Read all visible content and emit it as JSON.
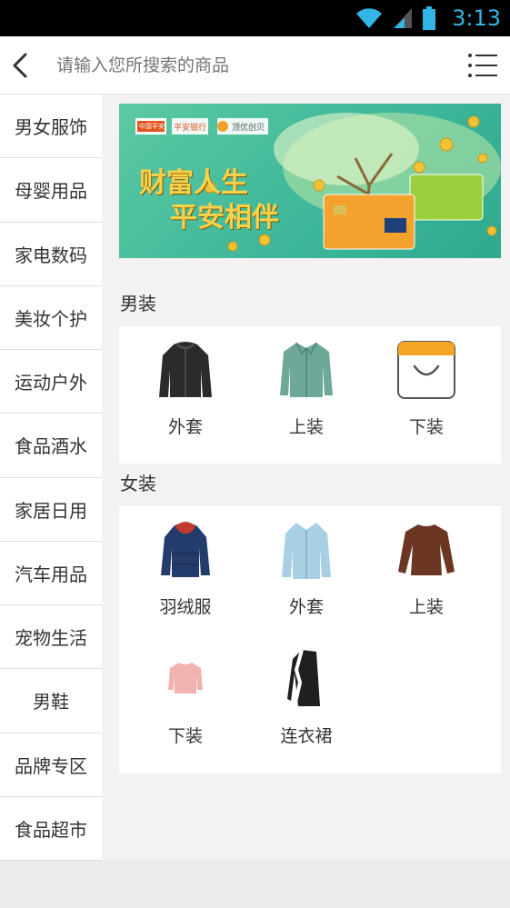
{
  "status": {
    "time": "3:13"
  },
  "search": {
    "placeholder": "请输入您所搜索的商品"
  },
  "sidebar": {
    "items": [
      {
        "label": "男女服饰"
      },
      {
        "label": "母婴用品"
      },
      {
        "label": "家电数码"
      },
      {
        "label": "美妆个护"
      },
      {
        "label": "运动户外"
      },
      {
        "label": "食品酒水"
      },
      {
        "label": "家居日用"
      },
      {
        "label": "汽车用品"
      },
      {
        "label": "宠物生活"
      },
      {
        "label": "男鞋"
      },
      {
        "label": "品牌专区"
      },
      {
        "label": "食品超市"
      }
    ]
  },
  "banner": {
    "logos": [
      "中国平安",
      "平安银行",
      "顶优创贝"
    ],
    "slogan_line1": "财富人生",
    "slogan_line2": "平安相伴"
  },
  "sections": [
    {
      "title": "男装",
      "items": [
        {
          "label": "外套",
          "icon": "jacket-icon"
        },
        {
          "label": "上装",
          "icon": "shirt-icon"
        },
        {
          "label": "下装",
          "icon": "shopping-bag-icon"
        }
      ]
    },
    {
      "title": "女装",
      "items": [
        {
          "label": "羽绒服",
          "icon": "down-jacket-icon"
        },
        {
          "label": "外套",
          "icon": "coat-icon"
        },
        {
          "label": "上装",
          "icon": "sweater-icon"
        },
        {
          "label": "下装",
          "icon": "pink-top-icon"
        },
        {
          "label": "连衣裙",
          "icon": "dress-icon"
        }
      ]
    }
  ],
  "colors": {
    "status_time": "#33b5e5",
    "banner_green": "#3eb79a",
    "bag_orange": "#f5a623"
  }
}
